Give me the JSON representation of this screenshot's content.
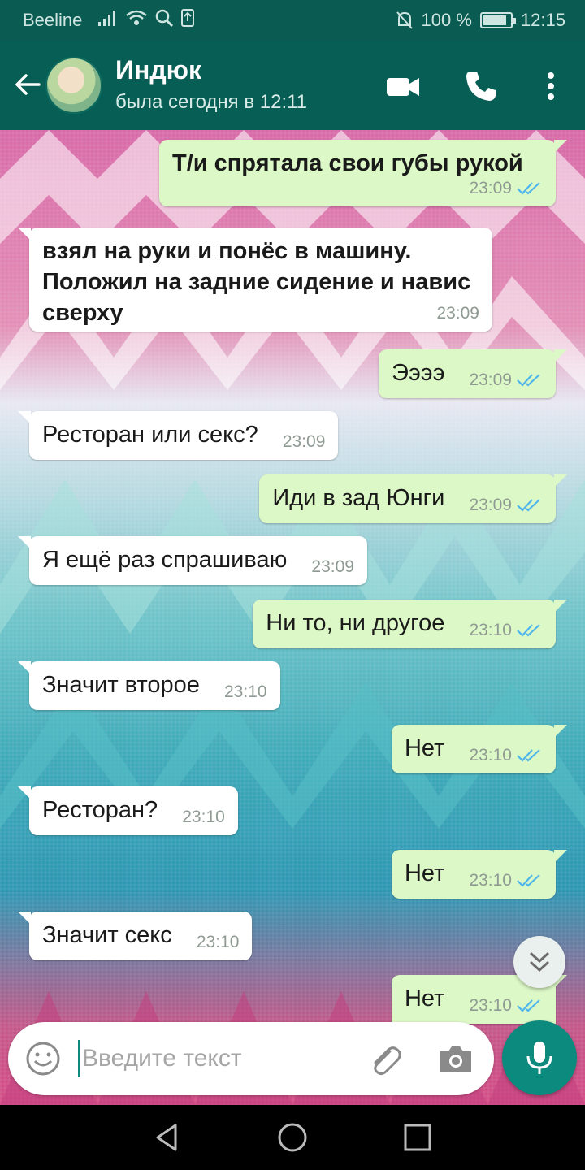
{
  "status_bar": {
    "carrier": "Beeline",
    "battery": "100 %",
    "time": "12:15"
  },
  "header": {
    "contact_name": "Индюк",
    "contact_status": "была сегодня в 12:11"
  },
  "messages": [
    {
      "direction": "out",
      "text": "Т/и спрятала свои губы рукой",
      "time": "23:09",
      "read": true
    },
    {
      "direction": "in",
      "text": "взял на руки и понёс в машину. Положил на задние сидение и навис сверху",
      "time": "23:09"
    },
    {
      "direction": "out",
      "text": "Ээээ",
      "time": "23:09",
      "read": true
    },
    {
      "direction": "in",
      "text": "Ресторан или секс?",
      "time": "23:09"
    },
    {
      "direction": "out",
      "text": "Иди в зад Юнги",
      "time": "23:09",
      "read": true
    },
    {
      "direction": "in",
      "text": "Я ещё раз спрашиваю",
      "time": "23:09"
    },
    {
      "direction": "out",
      "text": "Ни то, ни другое",
      "time": "23:10",
      "read": true
    },
    {
      "direction": "in",
      "text": "Значит второе",
      "time": "23:10"
    },
    {
      "direction": "out",
      "text": "Нет",
      "time": "23:10",
      "read": true
    },
    {
      "direction": "in",
      "text": "Ресторан?",
      "time": "23:10"
    },
    {
      "direction": "out",
      "text": "Нет",
      "time": "23:10",
      "read": true
    },
    {
      "direction": "in",
      "text": "Значит секс",
      "time": "23:10"
    },
    {
      "direction": "out",
      "text": "Нет",
      "time": "23:10",
      "read": true
    }
  ],
  "composer": {
    "placeholder": "Введите текст"
  },
  "colors": {
    "header": "#075e54",
    "outgoing_bubble": "#dcf8c6",
    "incoming_bubble": "#ffffff",
    "read_ticks": "#4fb6ec",
    "mic_button": "#0d8a7e"
  }
}
